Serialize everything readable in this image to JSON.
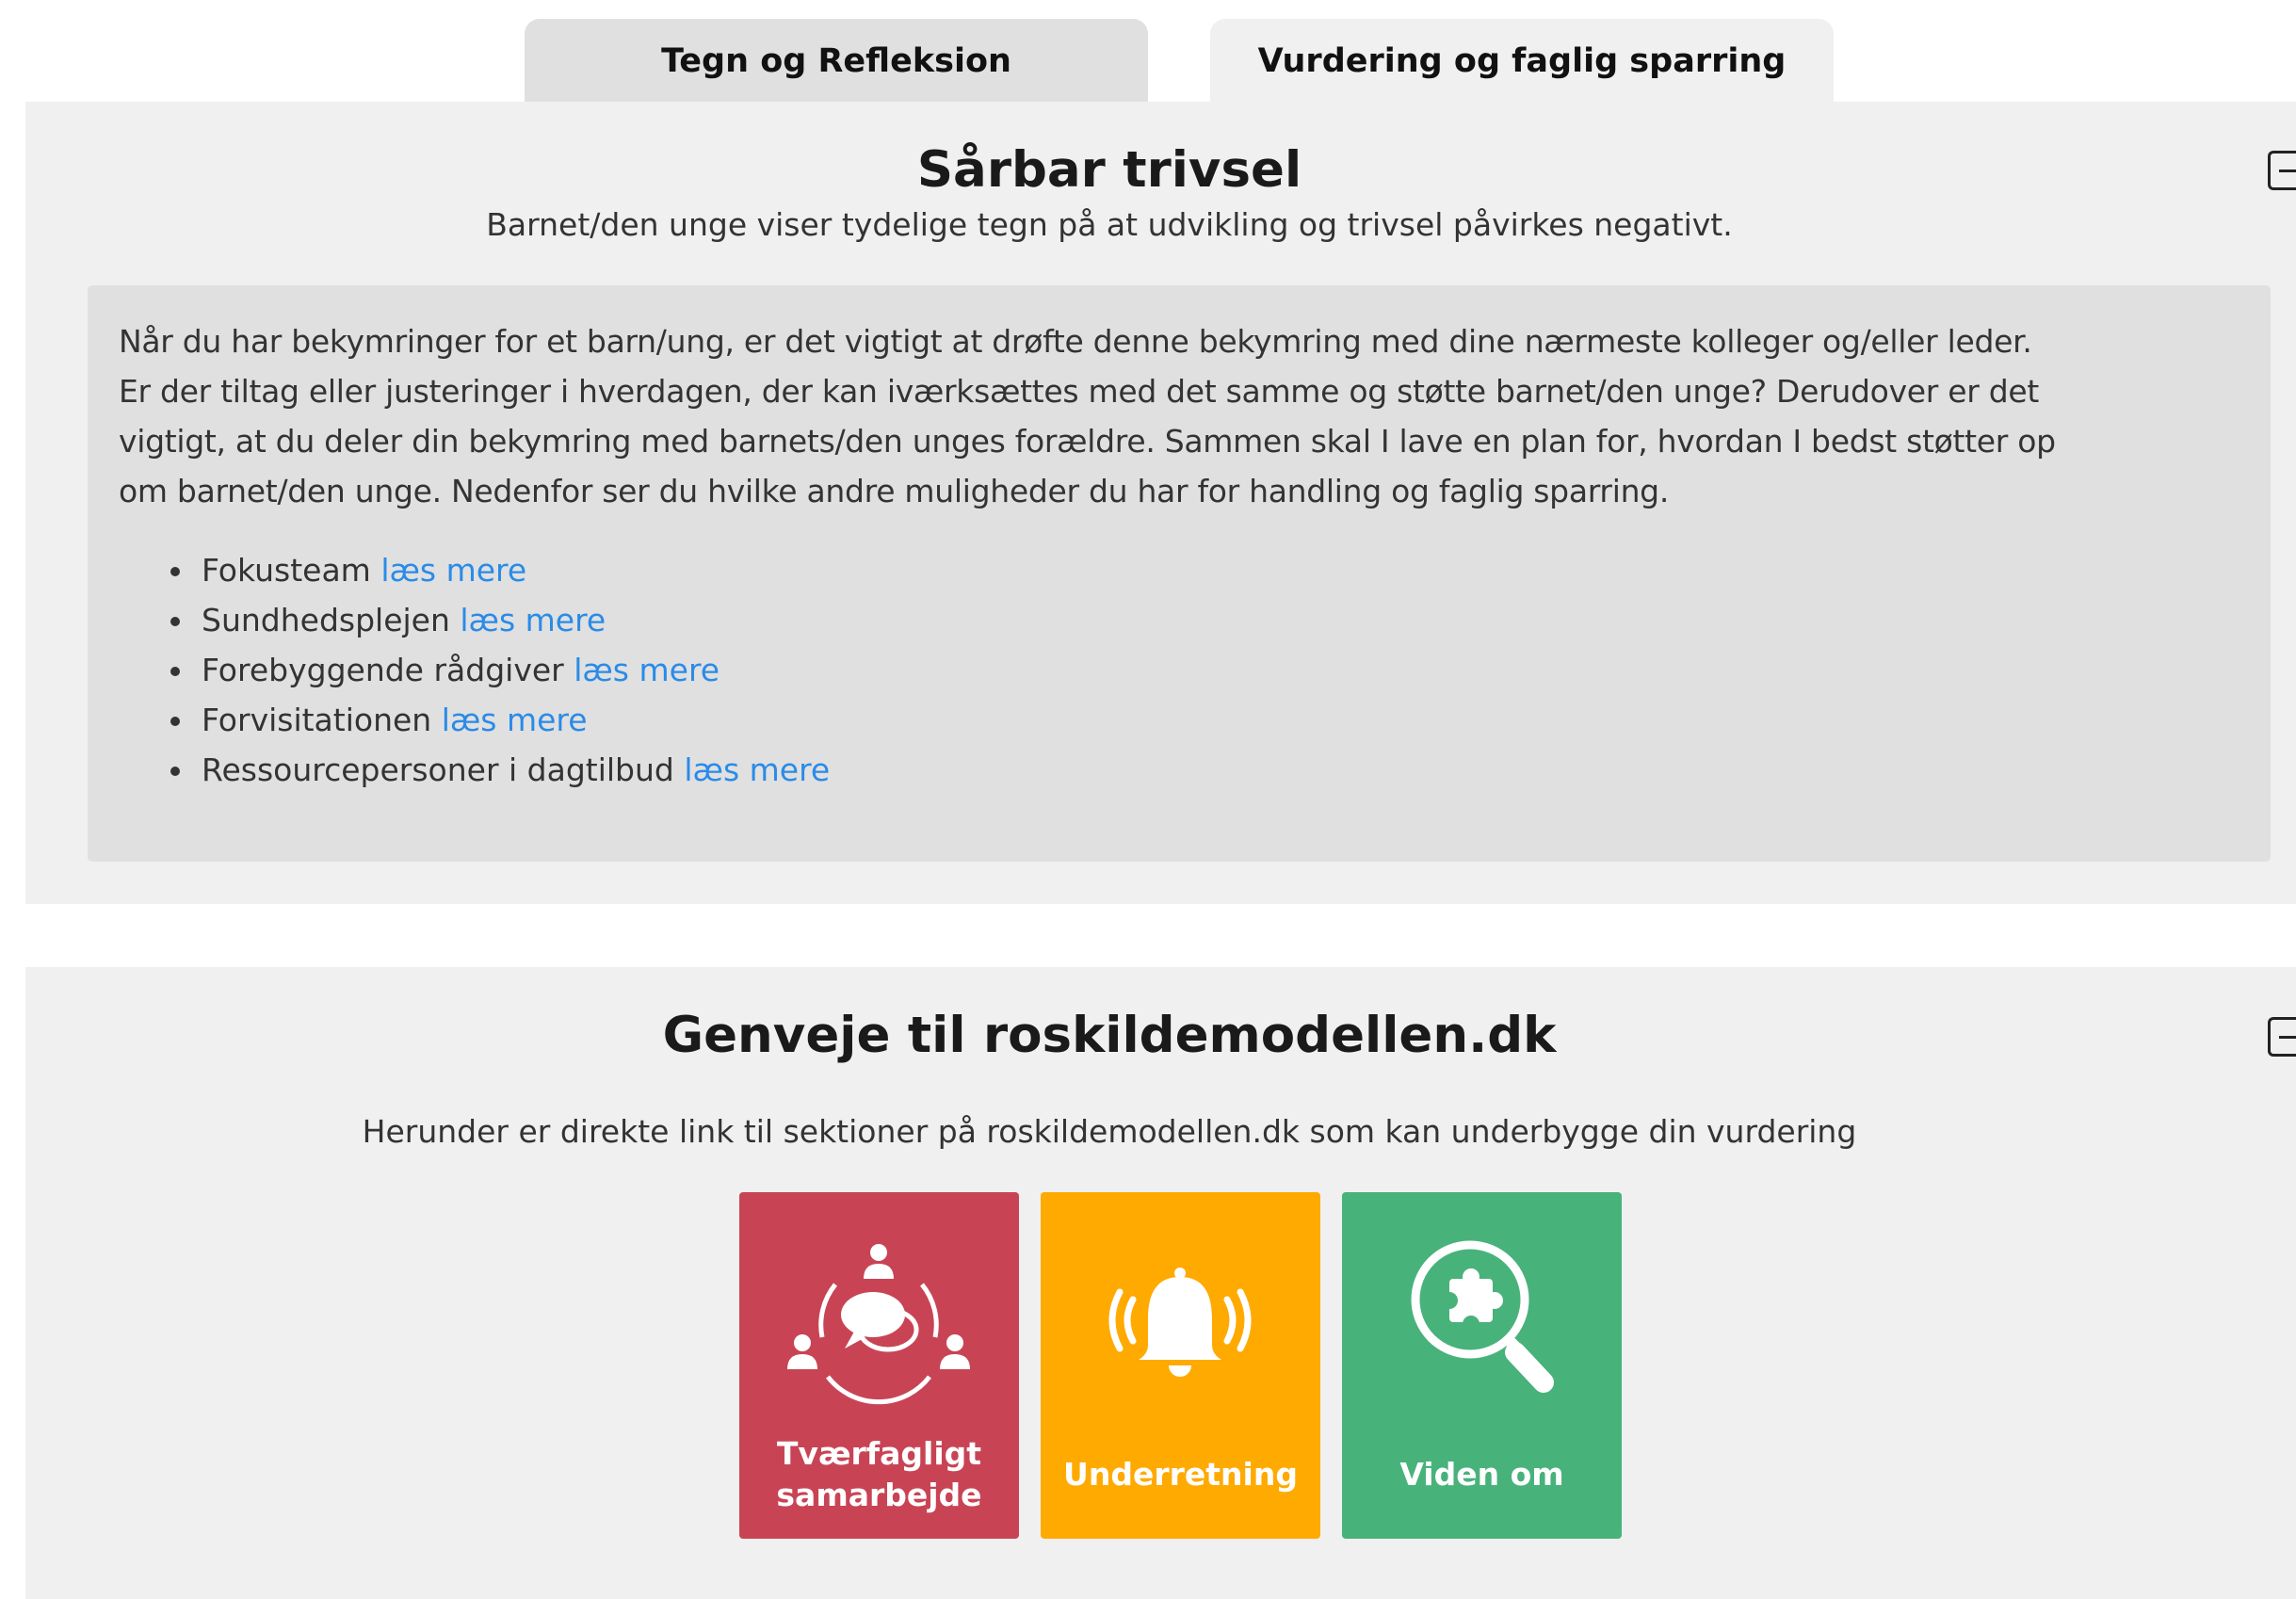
{
  "tabs": [
    {
      "label": "Tegn og Refleksion"
    },
    {
      "label": "Vurdering og faglig sparring"
    }
  ],
  "assessment_panel": {
    "title": "Sårbar trivsel",
    "subtitle": "Barnet/den unge viser tydelige tegn på at udvikling og trivsel påvirkes negativt.",
    "lines": [
      "Når du har bekymringer for et barn/ung, er det vigtigt at drøfte denne bekymring med dine nærmeste kolleger og/eller leder.",
      "Er der tiltag eller justeringer i hverdagen, der kan iværksættes med det samme og støtte barnet/den unge? Derudover er det",
      "vigtigt, at du deler din bekymring med barnets/den unges forældre. Sammen skal I lave en plan for, hvordan I bedst støtter op",
      "om barnet/den unge. Nedenfor ser du hvilke andre muligheder du har for handling og faglig sparring."
    ],
    "items": [
      {
        "label": "Fokusteam",
        "link": "læs mere"
      },
      {
        "label": "Sundhedsplejen",
        "link": "læs mere"
      },
      {
        "label": "Forebyggende rådgiver",
        "link": "læs mere"
      },
      {
        "label": "Forvisitationen",
        "link": "læs mere"
      },
      {
        "label": "Ressourcepersoner i dagtilbud",
        "link": "læs mere"
      }
    ]
  },
  "shortcuts_panel": {
    "title": "Genveje til roskildemodellen.dk",
    "subtitle": "Herunder er direkte link til sektioner på roskildemodellen.dk som kan underbygge din vurdering",
    "tiles": [
      {
        "line1": "Tværfagligt",
        "line2": "samarbejde",
        "icon": "collaboration-icon",
        "color": "#c84455"
      },
      {
        "line1": "Underretning",
        "icon": "bell-icon",
        "color": "#ffaa00"
      },
      {
        "line1": "Viden om",
        "icon": "search-puzzle-icon",
        "color": "#48b27b"
      }
    ]
  },
  "colors": {
    "panel_bg": "#f0f0f0",
    "info_bg": "#e0e0e0",
    "link": "#2a8be8"
  }
}
